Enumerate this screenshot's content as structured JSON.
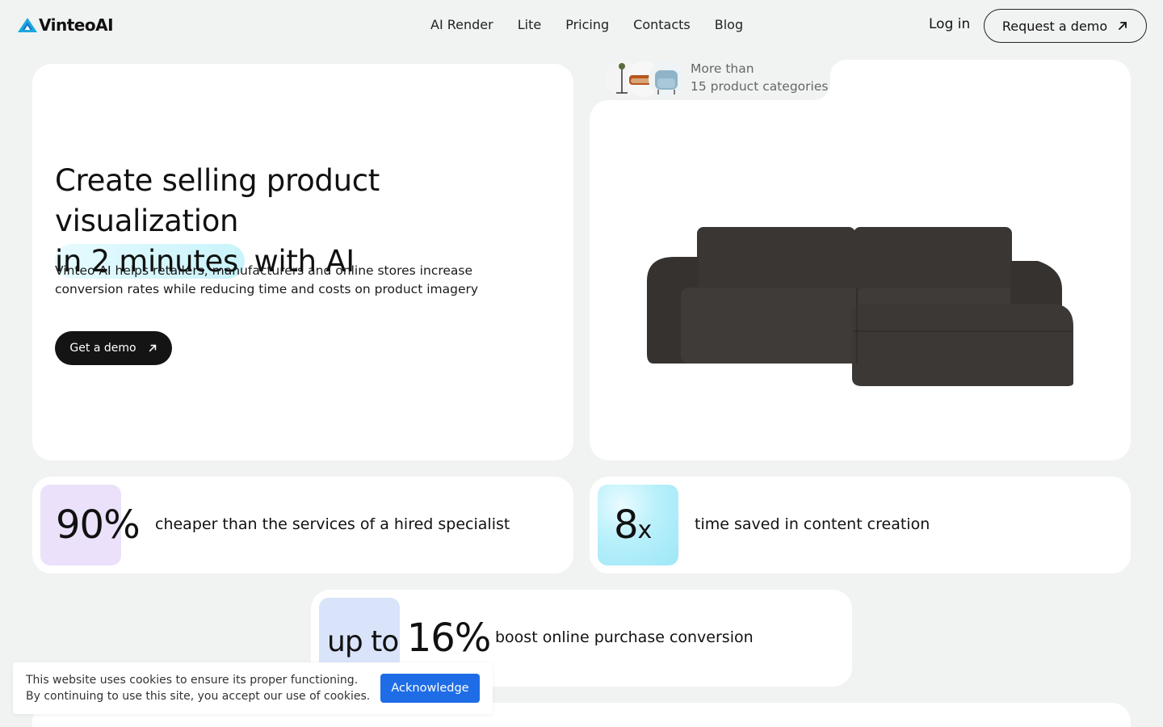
{
  "header": {
    "logo_text": "VinteoAI",
    "nav": [
      "AI Render",
      "Lite",
      "Pricing",
      "Contacts",
      "Blog"
    ],
    "login_label": "Log in",
    "request_demo_label": "Request a demo"
  },
  "hero": {
    "title_line1": "Create selling product visualization",
    "title_highlight": "in 2 minutes",
    "title_rest": "with AI",
    "description": "Vinteo AI helps retailers, manufacturers and online stores increase conversion rates while reducing time and costs on product imagery",
    "cta_label": "Get a demo"
  },
  "categories_chip": {
    "line1": "More than",
    "line2": "15 product categories"
  },
  "stats": [
    {
      "value": "90%",
      "label": "cheaper than the services of a hired specialist",
      "swatch_color": "#ebe1fb"
    },
    {
      "value": "8",
      "suffix": "x",
      "label": "time saved in content creation",
      "swatch_color": "#b7f0fb"
    },
    {
      "prefix": "up to ",
      "value": "16%",
      "label": "boost online purchase conversion",
      "swatch_color": "#d9e4fb"
    }
  ],
  "cookie": {
    "line1": "This website uses cookies to ensure its proper functioning.",
    "line2": "By continuing to use this site, you accept our use of cookies.",
    "button_label": "Acknowledge"
  },
  "colors": {
    "background": "#f1f3f2",
    "accent_blue": "#1e6de6",
    "logo_blue": "#1ba8e0",
    "highlight": "#c9f3fb"
  }
}
